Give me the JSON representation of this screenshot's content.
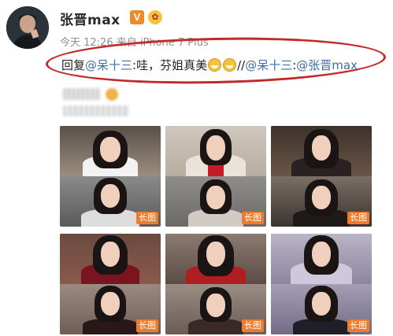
{
  "post": {
    "username": "张晋max",
    "verified_badge": "V",
    "fan_badge_icon": "fan-badge-icon",
    "time": "今天 12:26",
    "source": "来自 iPhone 7 Plus",
    "reply_prefix": "回复",
    "mention_1": "@呆十三",
    "reply_text": ":哇，芬姐真美",
    "separator": "//",
    "mention_2": "@呆十三",
    "colon": ":",
    "mention_3": "@张晋max",
    "highlight_color": "#c22a2a"
  },
  "repost": {
    "images": [
      {
        "label": "长图"
      },
      {
        "label": "长图"
      },
      {
        "label": "长图"
      },
      {
        "label": "长图"
      },
      {
        "label": "长图"
      },
      {
        "label": "长图"
      }
    ]
  }
}
